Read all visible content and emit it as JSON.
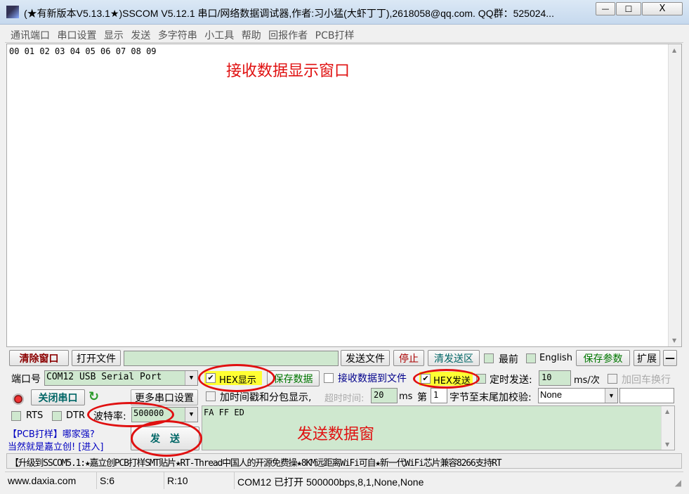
{
  "window": {
    "title": "(★有新版本V5.13.1★)SSCOM V5.12.1 串口/网络数据调试器,作者:习小猛(大虾丁丁),2618058@qq.com. QQ群：525024...",
    "min": "—",
    "max": "☐",
    "close": "X"
  },
  "menu": [
    "通讯端口",
    "串口设置",
    "显示",
    "发送",
    "多字符串",
    "小工具",
    "帮助",
    "回报作者",
    "PCB打样"
  ],
  "receive": {
    "text": "00 01 02 03 04 05 06 07 08 09",
    "annotation": "接收数据显示窗口"
  },
  "toolbar": {
    "clear": "清除窗口",
    "open_file": "打开文件",
    "file_path": "",
    "send_file": "发送文件",
    "stop": "停止",
    "clear_send": "清发送区",
    "topmost": "最前",
    "english": "English",
    "save_params": "保存参数",
    "expand": "扩展",
    "collapse": "—"
  },
  "port": {
    "label": "端口号",
    "value": "COM12 USB Serial Port",
    "close_port": "关闭串口",
    "more_settings": "更多串口设置",
    "rts": "RTS",
    "dtr": "DTR",
    "baud_label": "波特率:",
    "baud": "500000"
  },
  "options": {
    "hex_display": "HEX显示",
    "hex_display_checked": true,
    "save_data": "保存数据",
    "recv_to_file": "接收数据到文件",
    "hex_send": "HEX发送",
    "hex_send_checked": true,
    "timed_send": "定时发送:",
    "timed_value": "10",
    "timed_unit": "ms/次",
    "add_crlf": "加回车换行",
    "timestamp": "加时间戳和分包显示,",
    "timeout_label": "超时时间:",
    "timeout_value": "20",
    "timeout_unit": "ms",
    "nth": "第",
    "nth_value": "1",
    "checksum_label": "字节至末尾加校验:",
    "checksum": "None",
    "checksum_extra": ""
  },
  "send": {
    "text": "FA FF ED",
    "annotation": "发送数据窗",
    "button": "发　送"
  },
  "promo": {
    "line1": "【PCB打样】哪家强?",
    "line2": "当然就是嘉立创! [进入]"
  },
  "ticker": "【升级到SSCOM5.1:★嘉立创PCB打样SMT贴片★RT-Thread中国人的开源免费操★8KM远距离WiFi可自★新一代WiFi芯片兼容8266支持RT",
  "status": {
    "site": "www.daxia.com",
    "sent": "S:6",
    "recv": "R:10",
    "port_status": "COM12 已打开  500000bps,8,1,None,None"
  },
  "colors": {
    "annotation": "#e01010",
    "input_bg": "#cfe8cf",
    "highlight": "#ffff33"
  }
}
